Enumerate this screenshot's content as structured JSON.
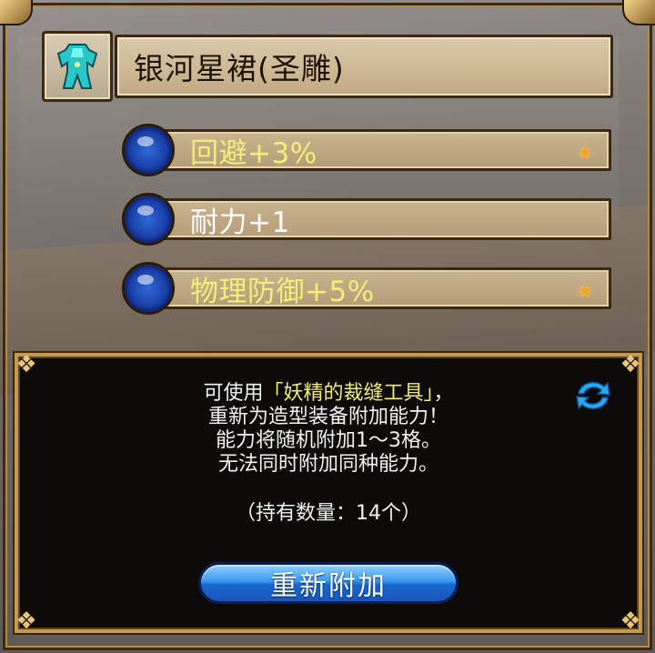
{
  "item": {
    "name": "银河星裙(圣雕)",
    "icon": "armor-icon"
  },
  "attributes": [
    {
      "label": "回避+3%",
      "color": "#f1ef7a",
      "starred": true
    },
    {
      "label": "耐力+1",
      "color": "#ffffff",
      "starred": false
    },
    {
      "label": "物理防御+5%",
      "color": "#f1ef7a",
      "starred": true
    }
  ],
  "info": {
    "line1_prefix": "可使用",
    "line1_item": "「妖精的裁缝工具」",
    "line1_suffix": "，",
    "line2": "重新为造型装备附加能力！",
    "line3": "能力将随机附加1～3格。",
    "line4": "无法同时附加同种能力。",
    "quantity": "（持有数量：14个）"
  },
  "button": {
    "label": "重新附加"
  },
  "colors": {
    "highlight": "#f2ec6a",
    "button_blue": "#1f6fd8",
    "panel_gold": "#c49a53"
  }
}
